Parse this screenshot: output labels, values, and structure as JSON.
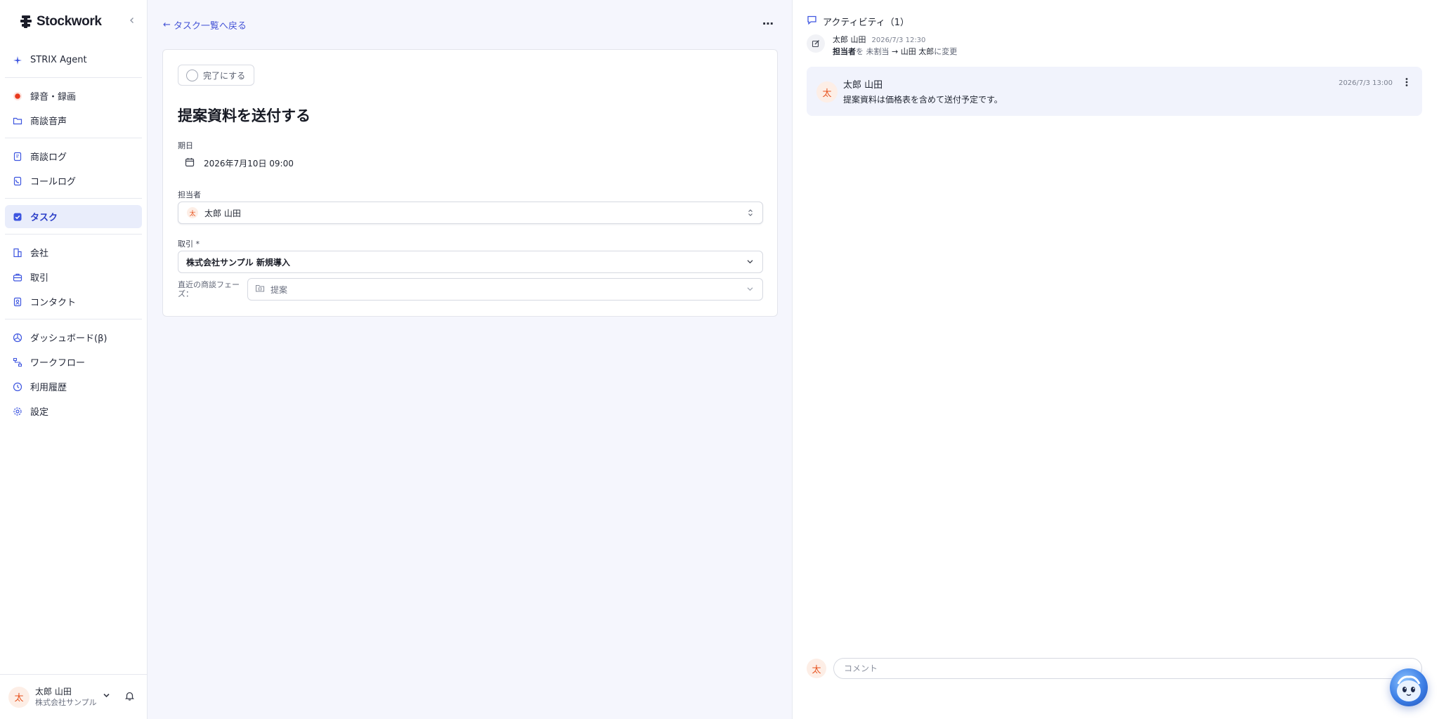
{
  "brand": {
    "name": "Stockwork"
  },
  "sidebar": {
    "items": [
      {
        "label": "STRIX Agent",
        "icon": "sparkle-icon"
      },
      {
        "label": "録音・録画",
        "icon": "record-icon"
      },
      {
        "label": "商談音声",
        "icon": "folder-icon"
      },
      {
        "label": "商談ログ",
        "icon": "document-icon"
      },
      {
        "label": "コールログ",
        "icon": "phone-log-icon"
      },
      {
        "label": "タスク",
        "icon": "check-square-icon",
        "active": true
      },
      {
        "label": "会社",
        "icon": "building-icon"
      },
      {
        "label": "取引",
        "icon": "briefcase-icon"
      },
      {
        "label": "コンタクト",
        "icon": "contact-icon"
      },
      {
        "label": "ダッシュボード(β)",
        "icon": "dashboard-icon"
      },
      {
        "label": "ワークフロー",
        "icon": "workflow-icon"
      },
      {
        "label": "利用履歴",
        "icon": "history-icon"
      },
      {
        "label": "設定",
        "icon": "gear-icon"
      }
    ],
    "user": {
      "avatar": "太",
      "name": "太郎 山田",
      "company": "株式会社サンプル"
    }
  },
  "main": {
    "back_label": "タスク一覧へ戻る",
    "more_label": "⋯",
    "complete_label": "完了にする",
    "task_title": "提案資料を送付する",
    "due": {
      "label": "期日",
      "value": "2026年7月10日 09:00"
    },
    "assignee": {
      "label": "担当者",
      "avatar": "太",
      "value": "太郎 山田"
    },
    "deal": {
      "label": "取引 *",
      "value": "株式会社サンプル 新規導入"
    },
    "phase": {
      "label": "直近の商談フェーズ：",
      "value": "提案"
    }
  },
  "activity": {
    "title": "アクティビティ（1）",
    "log": {
      "author": "太郎 山田",
      "time": "2026/7/3 12:30",
      "field": "担当者",
      "verb": "を",
      "from": "未割当",
      "arrow": "→",
      "to": "山田 太郎",
      "suffix": "に変更"
    },
    "comment": {
      "avatar": "太",
      "author": "太郎 山田",
      "time": "2026/7/3 13:00",
      "body": "提案資料は価格表を含めて送付予定です。"
    },
    "input": {
      "avatar": "太",
      "placeholder": "コメント"
    }
  },
  "colors": {
    "accent": "#3e56e0",
    "active_bg": "#e9edfb",
    "avatar_bg": "#fdeee6",
    "avatar_fg": "#e8521d"
  }
}
